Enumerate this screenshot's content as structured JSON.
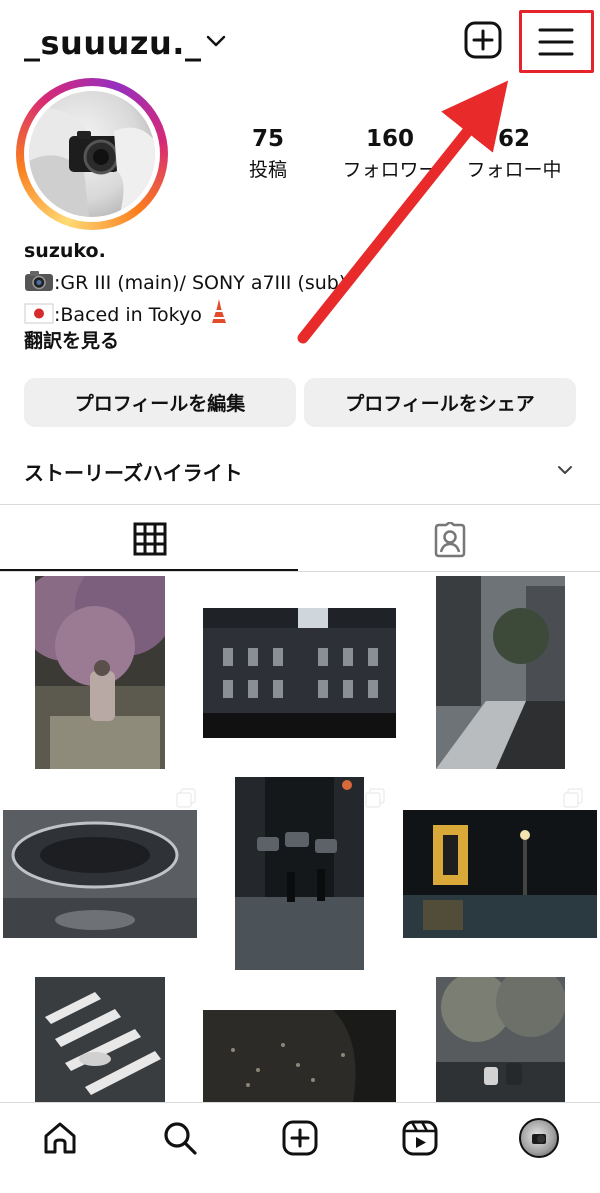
{
  "header": {
    "username": "_suuuzu._"
  },
  "profile": {
    "stats": [
      {
        "count": "75",
        "label": "投稿"
      },
      {
        "count": "160",
        "label": "フォロワー"
      },
      {
        "count": "62",
        "label": "フォロー中"
      }
    ],
    "display_name": "suzuko.",
    "bio_lines": [
      ":GR III (main)/ SONY a7III (sub)",
      ":Baced in Tokyo"
    ],
    "translate_label": "翻訳を見る"
  },
  "actions": {
    "edit_profile": "プロフィールを編集",
    "share_profile": "プロフィールをシェア"
  },
  "highlights": {
    "title": "ストーリーズハイライト"
  },
  "tabs": [
    {
      "name": "posts-grid",
      "selected": true
    },
    {
      "name": "tagged",
      "selected": false
    }
  ],
  "grid": {
    "posts": [
      {
        "subject": "cherry blossoms with person",
        "multi": false
      },
      {
        "subject": "Tokyo Station facade",
        "multi": false
      },
      {
        "subject": "city street with trees",
        "multi": false
      },
      {
        "subject": "abstract oval sculpture",
        "multi": true
      },
      {
        "subject": "night crossing with cars",
        "multi": true
      },
      {
        "subject": "izakaya street at night",
        "multi": false
      },
      {
        "subject": "crosswalk with umbrella",
        "multi": false
      },
      {
        "subject": "petals on pavement",
        "multi": false
      },
      {
        "subject": "couple on bench",
        "multi": false
      }
    ]
  },
  "bottom_nav": [
    "home-icon",
    "search-icon",
    "create-icon",
    "reels-icon",
    "profile-avatar"
  ],
  "colors": {
    "highlight": "#e5232a",
    "arrow": "#e82a2a",
    "button_bg": "#efefef"
  }
}
